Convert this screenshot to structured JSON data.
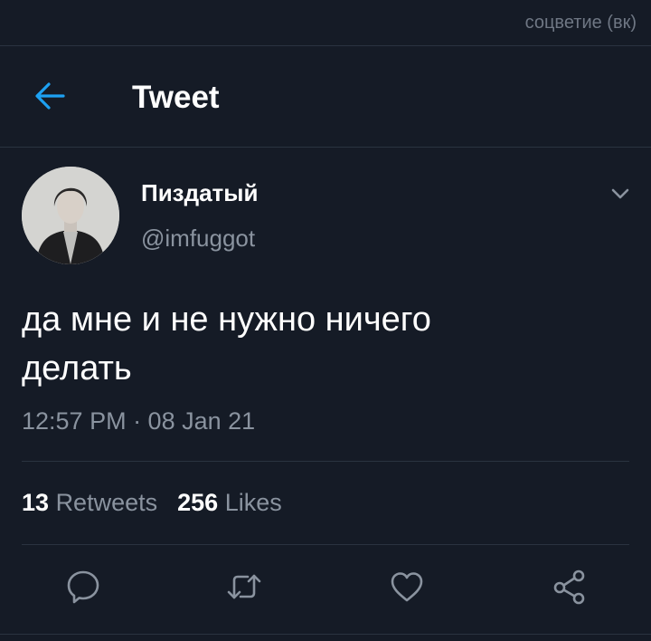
{
  "watermark": "соцветие (вк)",
  "header": {
    "title": "Tweet"
  },
  "tweet": {
    "display_name": "Пиздатый",
    "handle": "@imfuggot",
    "text_line1": "да мне и не нужно ничего",
    "text_line2": "делать",
    "timestamp": "12:57 PM · 08 Jan 21"
  },
  "stats": {
    "retweets_count": "13",
    "retweets_label": "Retweets",
    "likes_count": "256",
    "likes_label": "Likes"
  },
  "actions": [
    "reply-icon",
    "retweet-icon",
    "like-icon",
    "share-icon"
  ],
  "colors": {
    "background": "#151b26",
    "accent": "#1da1f2",
    "muted": "#8a939f",
    "divider": "#2a3340"
  }
}
